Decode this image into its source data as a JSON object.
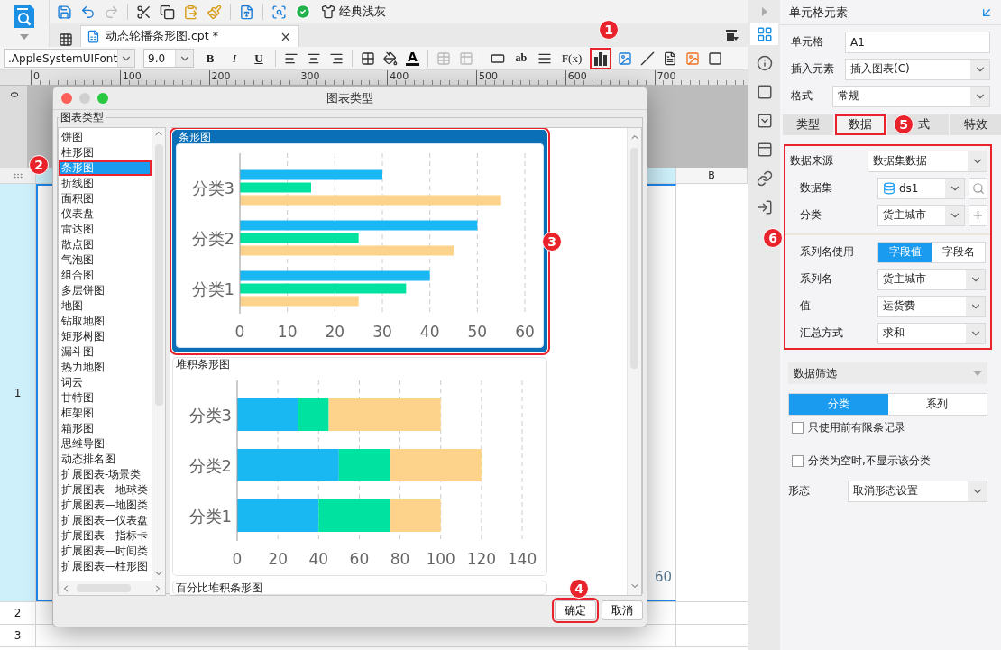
{
  "toolbar": {
    "theme_label": "经典浅灰"
  },
  "file_tab": {
    "title": "动态轮播条形图.cpt *",
    "close": "×"
  },
  "format_bar": {
    "font": ".AppleSystemUIFont",
    "size": "9.0",
    "bold": "B",
    "italic": "I",
    "underline": "U",
    "font_color": "A",
    "wrap": "ab",
    "formula": "F(x)",
    "chart_tool_marked": true
  },
  "ruler": [
    "0",
    "100",
    "200",
    "300",
    "400",
    "500",
    "600",
    "700"
  ],
  "vertical_ruler": "0",
  "sheet": {
    "column_b": "B",
    "rows": [
      {
        "label": "1",
        "selected": true
      },
      {
        "label": "2",
        "selected": false
      },
      {
        "label": "3",
        "selected": false
      }
    ],
    "a1_fragment": "60"
  },
  "dialog": {
    "title": "图表类型",
    "group": "图表类型",
    "types": [
      {
        "label": "饼图",
        "selected": false,
        "marked": false
      },
      {
        "label": "柱形图",
        "selected": false,
        "marked": false
      },
      {
        "label": "条形图",
        "selected": true,
        "marked": true
      },
      {
        "label": "折线图",
        "selected": false,
        "marked": false
      },
      {
        "label": "面积图",
        "selected": false,
        "marked": false
      },
      {
        "label": "仪表盘",
        "selected": false,
        "marked": false
      },
      {
        "label": "雷达图",
        "selected": false,
        "marked": false
      },
      {
        "label": "散点图",
        "selected": false,
        "marked": false
      },
      {
        "label": "气泡图",
        "selected": false,
        "marked": false
      },
      {
        "label": "组合图",
        "selected": false,
        "marked": false
      },
      {
        "label": "多层饼图",
        "selected": false,
        "marked": false
      },
      {
        "label": "地图",
        "selected": false,
        "marked": false
      },
      {
        "label": "钻取地图",
        "selected": false,
        "marked": false
      },
      {
        "label": "矩形树图",
        "selected": false,
        "marked": false
      },
      {
        "label": "漏斗图",
        "selected": false,
        "marked": false
      },
      {
        "label": "热力地图",
        "selected": false,
        "marked": false
      },
      {
        "label": "词云",
        "selected": false,
        "marked": false
      },
      {
        "label": "甘特图",
        "selected": false,
        "marked": false
      },
      {
        "label": "框架图",
        "selected": false,
        "marked": false
      },
      {
        "label": "箱形图",
        "selected": false,
        "marked": false
      },
      {
        "label": "思维导图",
        "selected": false,
        "marked": false
      },
      {
        "label": "动态排名图",
        "selected": false,
        "marked": false
      },
      {
        "label": "扩展图表-场景类",
        "selected": false,
        "marked": false
      },
      {
        "label": "扩展图表—地球类",
        "selected": false,
        "marked": false
      },
      {
        "label": "扩展图表—地图类",
        "selected": false,
        "marked": false
      },
      {
        "label": "扩展图表—仪表盘",
        "selected": false,
        "marked": false
      },
      {
        "label": "扩展图表—指标卡",
        "selected": false,
        "marked": false
      },
      {
        "label": "扩展图表—时间类",
        "selected": false,
        "marked": false
      },
      {
        "label": "扩展图表—柱形图",
        "selected": false,
        "marked": false
      }
    ],
    "previews": [
      {
        "title": "条形图",
        "selected": true,
        "marked": true,
        "chart_data": {
          "type": "bar",
          "orientation": "horizontal",
          "grid": true,
          "categories": [
            "分类3",
            "分类2",
            "分类1"
          ],
          "series": [
            {
              "color": "#1ab8f2",
              "values": [
                30,
                50,
                40
              ]
            },
            {
              "color": "#00e3a0",
              "values": [
                15,
                25,
                35
              ]
            },
            {
              "color": "#fdd38c",
              "values": [
                55,
                45,
                25
              ]
            }
          ],
          "xlim": [
            0,
            60
          ],
          "xticks": [
            0,
            10,
            20,
            30,
            40,
            50,
            60
          ]
        }
      },
      {
        "title": "堆积条形图",
        "selected": false,
        "marked": false,
        "chart_data": {
          "type": "bar",
          "orientation": "horizontal",
          "stacked": true,
          "grid": true,
          "categories": [
            "分类3",
            "分类2",
            "分类1"
          ],
          "series": [
            {
              "color": "#1ab8f2",
              "values": [
                30,
                50,
                40
              ]
            },
            {
              "color": "#00e3a0",
              "values": [
                15,
                25,
                35
              ]
            },
            {
              "color": "#fdd38c",
              "values": [
                55,
                45,
                25
              ]
            }
          ],
          "xlim": [
            0,
            140
          ],
          "xticks": [
            0,
            20,
            40,
            60,
            80,
            100,
            120,
            140
          ]
        }
      },
      {
        "title": "百分比堆积条形图",
        "selected": false,
        "marked": false
      }
    ],
    "buttons": [
      {
        "label": "确定",
        "marked": true
      },
      {
        "label": "取消",
        "marked": false
      }
    ]
  },
  "rail": [
    {
      "selected": true
    },
    {
      "selected": false
    },
    {
      "selected": false
    },
    {
      "selected": false
    },
    {
      "selected": false
    },
    {
      "selected": false
    },
    {
      "selected": false
    }
  ],
  "side_panel": {
    "title": "单元格元素",
    "fields": [
      {
        "label": "单元格",
        "value": "A1",
        "kind": "input"
      },
      {
        "label": "插入元素",
        "value": "插入图表(C)",
        "kind": "select"
      },
      {
        "label": "格式",
        "value": "常规",
        "kind": "select"
      }
    ],
    "tabs": [
      {
        "label": "类型",
        "selected": false,
        "marked": false
      },
      {
        "label": "数据",
        "selected": true,
        "marked": true
      },
      {
        "label": "式",
        "selected": false,
        "marked": false
      },
      {
        "label": "特效",
        "selected": false,
        "marked": false
      }
    ],
    "data_group": {
      "marked": true,
      "source": {
        "label": "数据来源",
        "value": "数据集数据"
      },
      "dataset": {
        "label": "数据集",
        "value": "ds1"
      },
      "category": {
        "label": "分类",
        "value": "货主城市"
      },
      "series_name_use": {
        "label": "系列名使用",
        "options": [
          {
            "label": "字段值",
            "selected": true
          },
          {
            "label": "字段名",
            "selected": false
          }
        ]
      },
      "series_fields": [
        {
          "label": "系列名",
          "value": "货主城市"
        },
        {
          "label": "值",
          "value": "运货费"
        },
        {
          "label": "汇总方式",
          "value": "求和"
        }
      ]
    },
    "filter": {
      "title": "数据筛选"
    },
    "filter_tabs": [
      {
        "label": "分类",
        "selected": true
      },
      {
        "label": "系列",
        "selected": false
      }
    ],
    "checks": [
      {
        "label": "只使用前有限条记录",
        "checked": false
      },
      {
        "label": "分类为空时,不显示该分类",
        "checked": false
      }
    ],
    "shape": {
      "label": "形态",
      "value": "取消形态设置"
    }
  },
  "annotations": [
    {
      "label": "1"
    },
    {
      "label": "2"
    },
    {
      "label": "3"
    },
    {
      "label": "4"
    },
    {
      "label": "5"
    },
    {
      "label": "6"
    }
  ]
}
